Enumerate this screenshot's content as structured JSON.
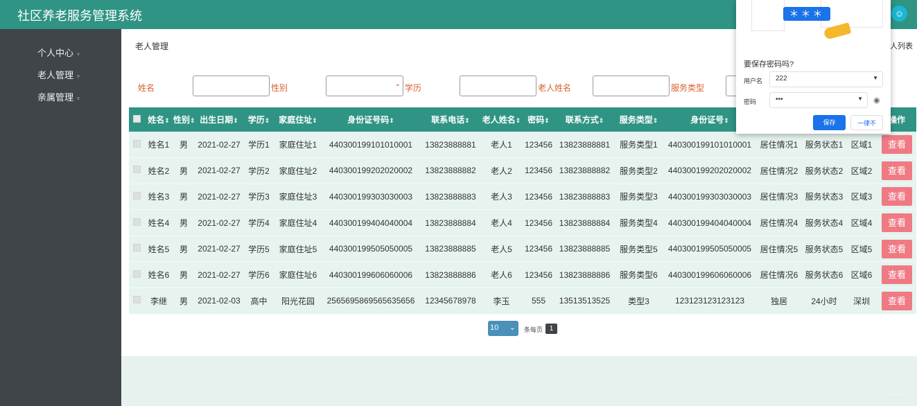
{
  "app": {
    "title": "社区养老服务管理系统",
    "avatar_icon": "user-icon"
  },
  "sidebar": {
    "items": [
      {
        "label": "个人中心"
      },
      {
        "label": "老人管理"
      },
      {
        "label": "亲属管理"
      }
    ]
  },
  "breadcrumb": {
    "current": "老人管理",
    "right": "人列表"
  },
  "search": {
    "fields": [
      {
        "label": "姓名",
        "value": ""
      },
      {
        "label": "性别",
        "value": ""
      },
      {
        "label": "学历",
        "value": ""
      },
      {
        "label": "老人姓名",
        "value": ""
      },
      {
        "label": "服务类型",
        "value": ""
      }
    ]
  },
  "table": {
    "headers": [
      "姓名",
      "性别",
      "出生日期",
      "学历",
      "家庭住址",
      "身份证号码",
      "联系电话",
      "老人姓名",
      "密码",
      "联系方式",
      "服务类型",
      "身份证号",
      "",
      "",
      "",
      "操作"
    ],
    "rows": [
      [
        "姓名1",
        "男",
        "2021-02-27",
        "学历1",
        "家庭住址1",
        "440300199101010001",
        "13823888881",
        "老人1",
        "123456",
        "13823888881",
        "服务类型1",
        "440300199101010001",
        "居住情况1",
        "服务状态1",
        "区域1"
      ],
      [
        "姓名2",
        "男",
        "2021-02-27",
        "学历2",
        "家庭住址2",
        "440300199202020002",
        "13823888882",
        "老人2",
        "123456",
        "13823888882",
        "服务类型2",
        "440300199202020002",
        "居住情况2",
        "服务状态2",
        "区域2"
      ],
      [
        "姓名3",
        "男",
        "2021-02-27",
        "学历3",
        "家庭住址3",
        "440300199303030003",
        "13823888883",
        "老人3",
        "123456",
        "13823888883",
        "服务类型3",
        "440300199303030003",
        "居住情况3",
        "服务状态3",
        "区域3"
      ],
      [
        "姓名4",
        "男",
        "2021-02-27",
        "学历4",
        "家庭住址4",
        "440300199404040004",
        "13823888884",
        "老人4",
        "123456",
        "13823888884",
        "服务类型4",
        "440300199404040004",
        "居住情况4",
        "服务状态4",
        "区域4"
      ],
      [
        "姓名5",
        "男",
        "2021-02-27",
        "学历5",
        "家庭住址5",
        "440300199505050005",
        "13823888885",
        "老人5",
        "123456",
        "13823888885",
        "服务类型5",
        "440300199505050005",
        "居住情况5",
        "服务状态5",
        "区域5"
      ],
      [
        "姓名6",
        "男",
        "2021-02-27",
        "学历6",
        "家庭住址6",
        "440300199606060006",
        "13823888886",
        "老人6",
        "123456",
        "13823888886",
        "服务类型6",
        "440300199606060006",
        "居住情况6",
        "服务状态6",
        "区域6"
      ],
      [
        "李继",
        "男",
        "2021-02-03",
        "高中",
        "阳光花园",
        "2565695869565635656",
        "12345678978",
        "李玉",
        "555",
        "13513513525",
        "类型3",
        "123123123123123",
        "独居",
        "24小时",
        "深圳"
      ]
    ],
    "view_label": "查看"
  },
  "pagination": {
    "page_size": "10",
    "per_page_label": "条每页",
    "current_page": "1"
  },
  "password_popup": {
    "masked": "＊＊＊",
    "question": "要保存密码吗?",
    "username_label": "用户名",
    "username": "222",
    "password_label": "密码",
    "password": "•••",
    "save_label": "保存",
    "never_label": "一律不"
  },
  "colors": {
    "header": "#2f9484",
    "sidebar": "#3f4549",
    "view_button": "#ef7a84",
    "save_button": "#1a73e8"
  }
}
